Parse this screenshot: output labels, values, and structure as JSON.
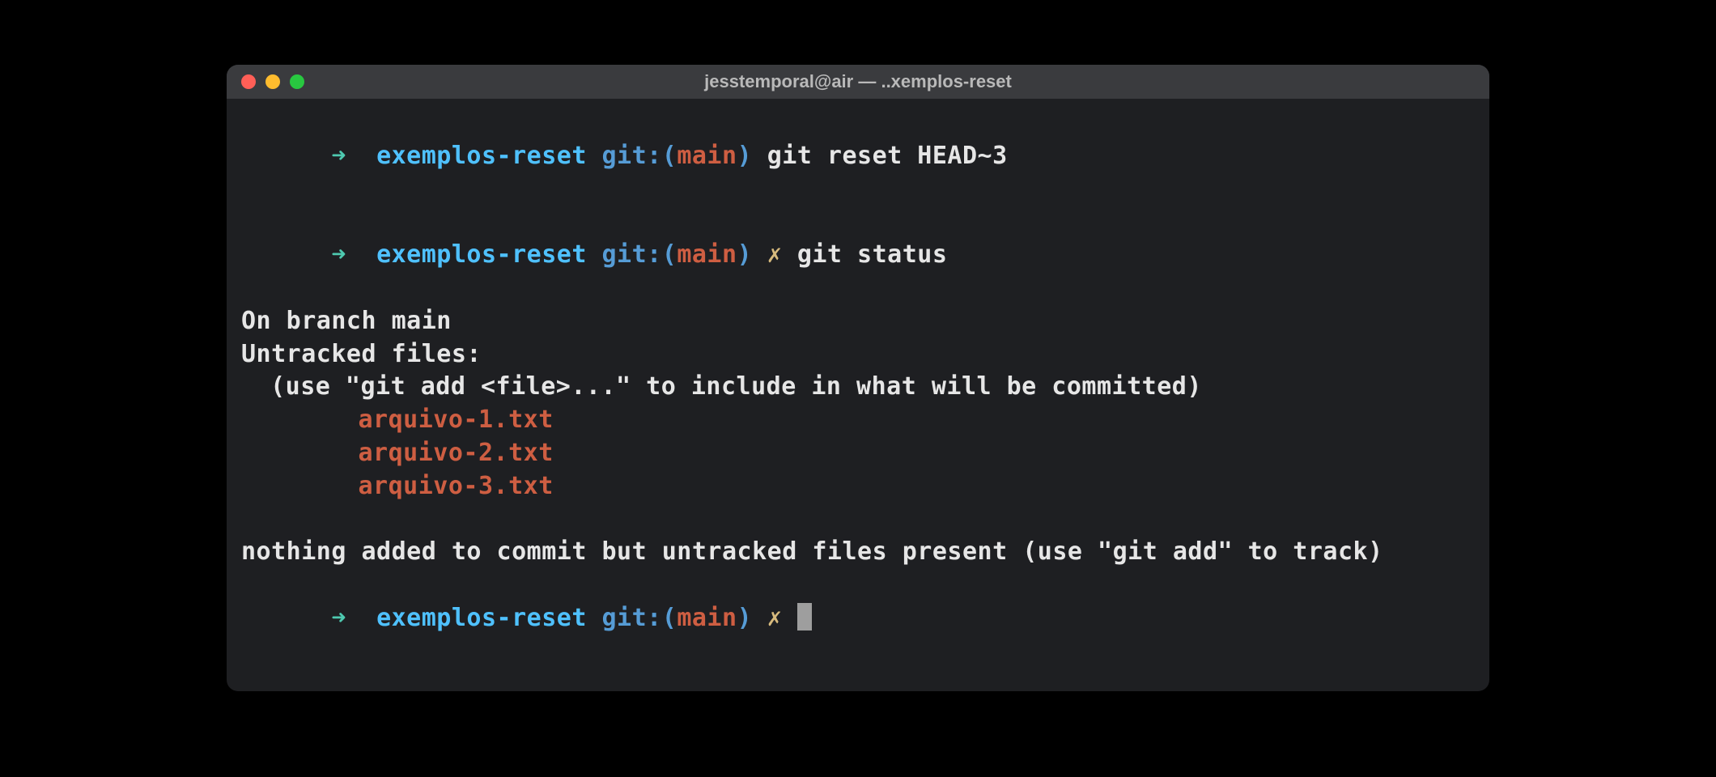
{
  "window": {
    "title": "jesstemporal@air — ..xemplos-reset"
  },
  "prompt": {
    "arrow": "➜",
    "directory": "exemplos-reset",
    "git_prefix": "git:",
    "paren_open": "(",
    "branch": "main",
    "paren_close": ")",
    "dirty": "✗"
  },
  "commands": {
    "cmd1": "git reset HEAD~3",
    "cmd2": "git status"
  },
  "output": {
    "branch_line": "On branch main",
    "untracked_header": "Untracked files:",
    "untracked_hint": "(use \"git add <file>...\" to include in what will be committed)",
    "files": {
      "f1": "arquivo-1.txt",
      "f2": "arquivo-2.txt",
      "f3": "arquivo-3.txt"
    },
    "footer": "nothing added to commit but untracked files present (use \"git add\" to track)"
  }
}
